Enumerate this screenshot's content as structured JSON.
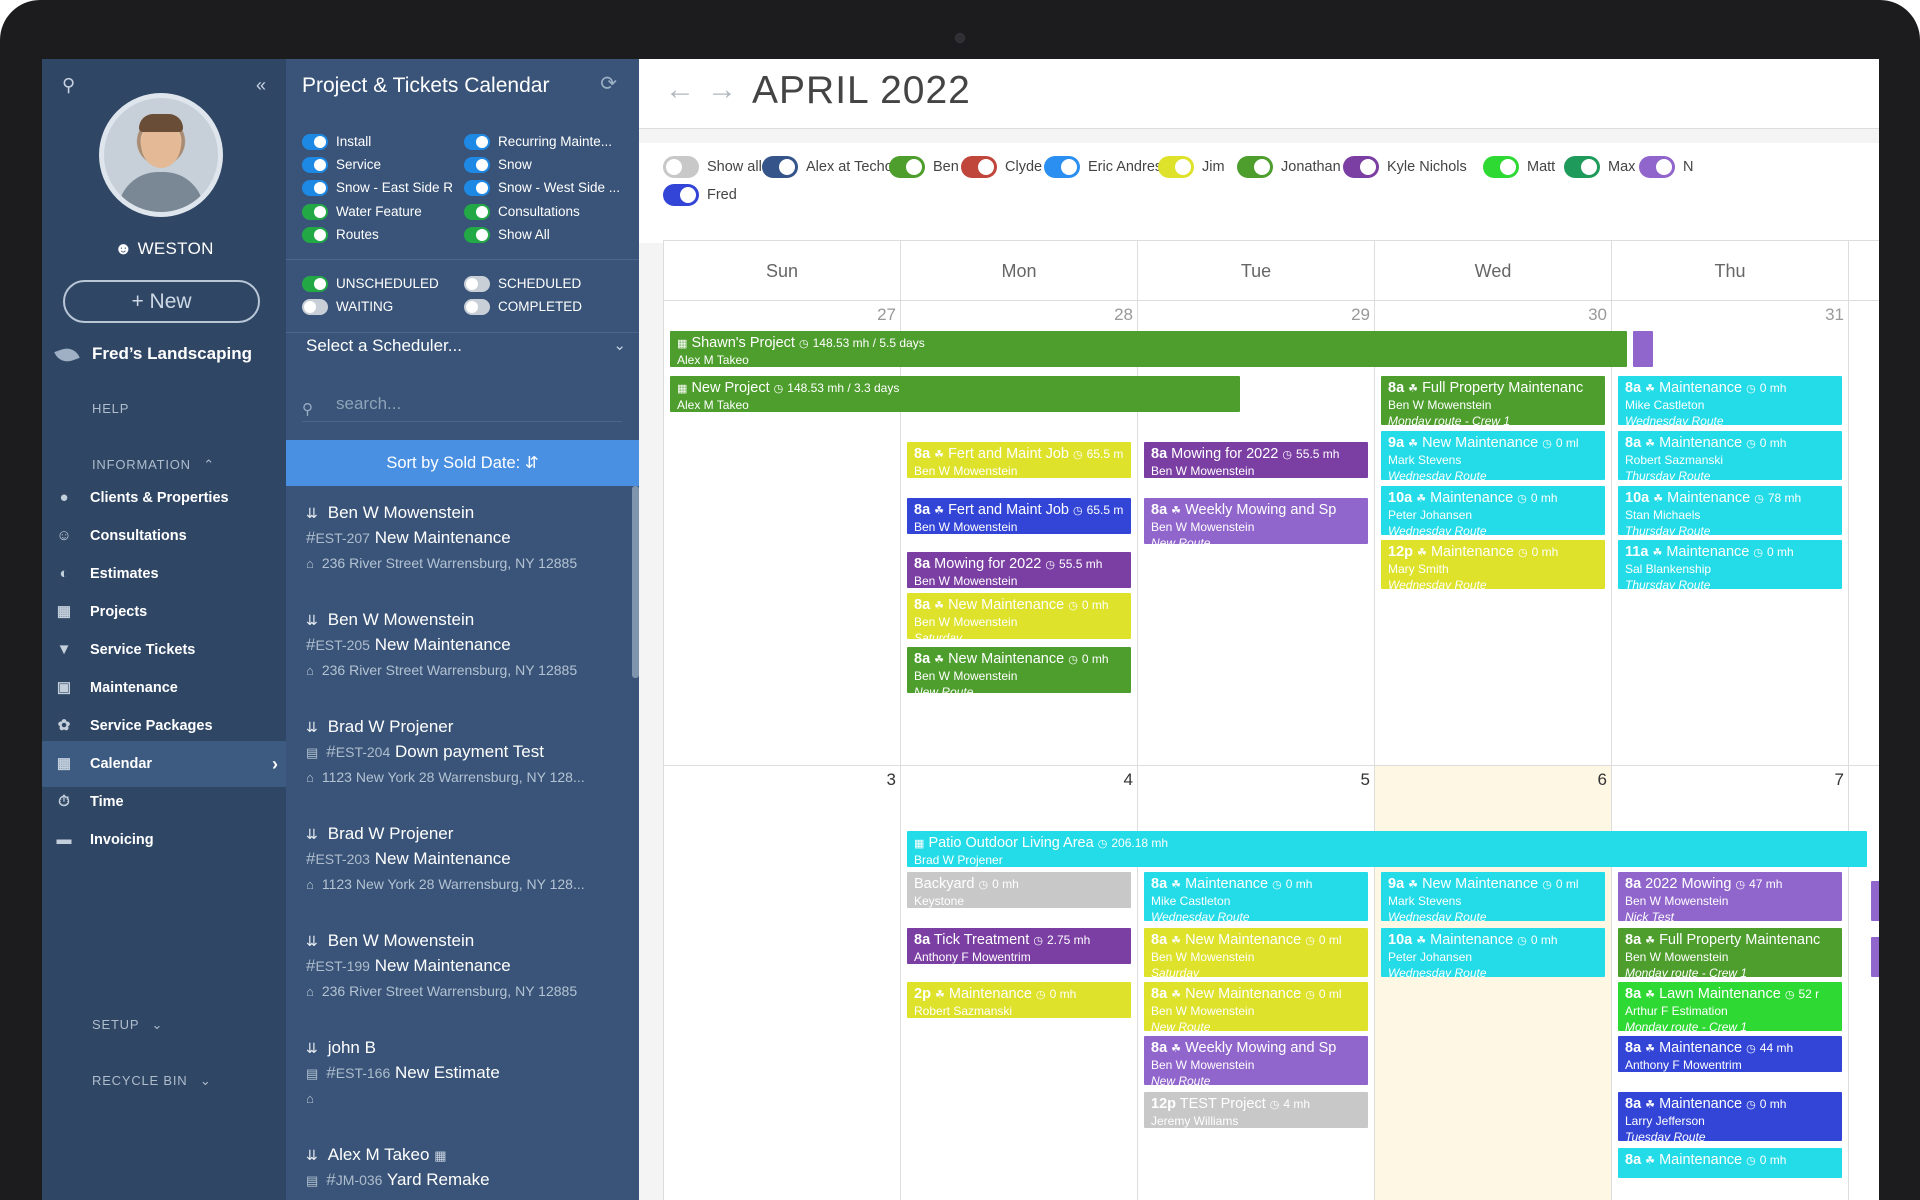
{
  "app": {
    "title": "Project & Tickets Calendar"
  },
  "sidebar": {
    "user": "WESTON",
    "new_label": "New",
    "company": "Fred’s Landscaping",
    "help": "HELP",
    "information": "INFORMATION",
    "setup": "SETUP",
    "recycle_bin": "RECYCLE BIN",
    "items": [
      {
        "label": "Clients & Properties",
        "icon": "clients-icon"
      },
      {
        "label": "Consultations",
        "icon": "consultations-icon"
      },
      {
        "label": "Estimates",
        "icon": "estimates-icon"
      },
      {
        "label": "Projects",
        "icon": "projects-icon"
      },
      {
        "label": "Service Tickets",
        "icon": "service-tickets-icon"
      },
      {
        "label": "Maintenance",
        "icon": "maintenance-icon"
      },
      {
        "label": "Service Packages",
        "icon": "service-packages-icon"
      },
      {
        "label": "Calendar",
        "icon": "calendar-icon"
      },
      {
        "label": "Time",
        "icon": "time-icon"
      },
      {
        "label": "Invoicing",
        "icon": "invoicing-icon"
      }
    ]
  },
  "panel": {
    "filters_left": [
      "Install",
      "Service",
      "Snow - East Side R...",
      "Water Feature",
      "Routes"
    ],
    "filters_right": [
      "Recurring Mainte...",
      "Snow",
      "Snow - West Side ...",
      "Consultations",
      "Show All"
    ],
    "status": {
      "unscheduled": "UNSCHEDULED",
      "waiting": "WAITING",
      "scheduled": "SCHEDULED",
      "completed": "COMPLETED"
    },
    "scheduler_placeholder": "Select a Scheduler...",
    "search_placeholder": "search...",
    "sort_label": "Sort by Sold Date:",
    "estimates": [
      {
        "name": "Ben W Mowenstein",
        "code": "EST-207",
        "title": "New Maintenance",
        "address": "236 River Street Warrensburg, NY 12885"
      },
      {
        "name": "Ben W Mowenstein",
        "code": "EST-205",
        "title": "New Maintenance",
        "address": "236 River Street Warrensburg, NY 12885"
      },
      {
        "name": "Brad W Projener",
        "code": "EST-204",
        "title": "Down payment Test",
        "address": "1123 New York 28 Warrensburg, NY 128..."
      },
      {
        "name": "Brad W Projener",
        "code": "EST-203",
        "title": "New Maintenance",
        "address": "1123 New York 28 Warrensburg, NY 128..."
      },
      {
        "name": "Ben W Mowenstein",
        "code": "EST-199",
        "title": "New Maintenance",
        "address": "236 River Street Warrensburg, NY 12885"
      },
      {
        "name": "john B",
        "code": "EST-166",
        "title": "New Estimate",
        "address": ""
      },
      {
        "name": "Alex M Takeo",
        "code": "JM-036",
        "title": "Yard Remake",
        "address": ""
      }
    ]
  },
  "calendar": {
    "month": "APRIL 2022",
    "people": [
      {
        "name": "Show all",
        "color": "#c8c8c8",
        "on": false
      },
      {
        "name": "Alex at Techo",
        "color": "#34548a",
        "on": true
      },
      {
        "name": "Ben",
        "color": "#4e9e2e",
        "on": true
      },
      {
        "name": "Clyde",
        "color": "#c0453a",
        "on": true
      },
      {
        "name": "Eric Andres",
        "color": "#2a8ff0",
        "on": true
      },
      {
        "name": "Jim",
        "color": "#dee22a",
        "on": true
      },
      {
        "name": "Jonathan",
        "color": "#4e9e2e",
        "on": true
      },
      {
        "name": "Kyle Nichols",
        "color": "#7b3ea3",
        "on": true
      },
      {
        "name": "Matt",
        "color": "#2fd934",
        "on": true
      },
      {
        "name": "Max",
        "color": "#1e9a5a",
        "on": true
      },
      {
        "name": "N",
        "color": "#9166cc",
        "on": true
      },
      {
        "name": "Fred",
        "color": "#3345d6",
        "on": true
      }
    ],
    "days": [
      "Sun",
      "Mon",
      "Tue",
      "Wed",
      "Thu"
    ],
    "week1_dates": [
      "27",
      "28",
      "29",
      "30",
      "31"
    ],
    "week2_dates": [
      "3",
      "4",
      "5",
      "6",
      "7"
    ],
    "events": {
      "shawn": {
        "title": "Shawn's Project",
        "meta": "148.53 mh / 5.5 days",
        "who": "Alex M Takeo"
      },
      "newproj": {
        "title": "New Project",
        "meta": "148.53 mh / 3.3 days",
        "who": "Alex M Takeo"
      },
      "patio": {
        "title": "Patio Outdoor Living Area",
        "meta": "206.18 mh",
        "who": "Brad W Projener"
      },
      "w1": [
        {
          "id": "mon1",
          "time": "8a",
          "title": "Fert and Maint Job",
          "mh": "65.5 m",
          "who": "Ben W Mowenstein",
          "route": ""
        },
        {
          "id": "mon2",
          "time": "8a",
          "title": "Fert and Maint Job",
          "mh": "65.5 m",
          "who": "Ben W Mowenstein",
          "route": ""
        },
        {
          "id": "mon3",
          "time": "8a",
          "title": "Mowing for 2022",
          "mh": "55.5 mh",
          "who": "Ben W Mowenstein",
          "route": ""
        },
        {
          "id": "mon4",
          "time": "8a",
          "title": "New Maintenance",
          "mh": "0 mh",
          "who": "Ben W Mowenstein",
          "route": "Saturday"
        },
        {
          "id": "mon5",
          "time": "8a",
          "title": "New Maintenance",
          "mh": "0 mh",
          "who": "Ben W Mowenstein",
          "route": "New Route"
        },
        {
          "id": "tue1",
          "time": "8a",
          "title": "Mowing for 2022",
          "mh": "55.5 mh",
          "who": "Ben W Mowenstein",
          "route": ""
        },
        {
          "id": "tue2",
          "time": "8a",
          "title": "Weekly Mowing and Sp",
          "mh": "",
          "who": "Ben W Mowenstein",
          "route": "New Route"
        },
        {
          "id": "wed1",
          "time": "8a",
          "title": "Full Property Maintenanc",
          "mh": "",
          "who": "Ben W Mowenstein",
          "route": "Monday route - Crew 1"
        },
        {
          "id": "wed2",
          "time": "9a",
          "title": "New Maintenance",
          "mh": "0 ml",
          "who": "Mark Stevens",
          "route": "Wednesday Route"
        },
        {
          "id": "wed3",
          "time": "10a",
          "title": "Maintenance",
          "mh": "0 mh",
          "who": "Peter Johansen",
          "route": "Wednesday Route"
        },
        {
          "id": "wed4",
          "time": "12p",
          "title": "Maintenance",
          "mh": "0 mh",
          "who": "Mary Smith",
          "route": "Wednesday Route"
        },
        {
          "id": "thu1",
          "time": "8a",
          "title": "Maintenance",
          "mh": "0 mh",
          "who": "Mike Castleton",
          "route": "Wednesday Route"
        },
        {
          "id": "thu2",
          "time": "8a",
          "title": "Maintenance",
          "mh": "0 mh",
          "who": "Robert Sazmanski",
          "route": "Thursday Route"
        },
        {
          "id": "thu3",
          "time": "10a",
          "title": "Maintenance",
          "mh": "78 mh",
          "who": "Stan Michaels",
          "route": "Thursday Route"
        },
        {
          "id": "thu4",
          "time": "11a",
          "title": "Maintenance",
          "mh": "0 mh",
          "who": "Sal Blankenship",
          "route": "Thursday Route"
        }
      ],
      "w2": [
        {
          "id": "mon6",
          "time": "",
          "title": "Backyard",
          "mh": "0 mh",
          "who": "Keystone",
          "route": ""
        },
        {
          "id": "mon7",
          "time": "8a",
          "title": "Tick Treatment",
          "mh": "2.75 mh",
          "who": "Anthony F Mowentrim",
          "route": ""
        },
        {
          "id": "mon8",
          "time": "2p",
          "title": "Maintenance",
          "mh": "0 mh",
          "who": "Robert Sazmanski",
          "route": ""
        },
        {
          "id": "tue3",
          "time": "8a",
          "title": "Maintenance",
          "mh": "0 mh",
          "who": "Mike Castleton",
          "route": "Wednesday Route"
        },
        {
          "id": "tue4",
          "time": "8a",
          "title": "New Maintenance",
          "mh": "0 ml",
          "who": "Ben W Mowenstein",
          "route": "Saturday"
        },
        {
          "id": "tue5",
          "time": "8a",
          "title": "New Maintenance",
          "mh": "0 ml",
          "who": "Ben W Mowenstein",
          "route": "New Route"
        },
        {
          "id": "tue6",
          "time": "8a",
          "title": "Weekly Mowing and Sp",
          "mh": "",
          "who": "Ben W Mowenstein",
          "route": "New Route"
        },
        {
          "id": "tue7",
          "time": "12p",
          "title": "TEST Project",
          "mh": "4 mh",
          "who": "Jeremy Williams",
          "route": ""
        },
        {
          "id": "wed5",
          "time": "9a",
          "title": "New Maintenance",
          "mh": "0 ml",
          "who": "Mark Stevens",
          "route": "Wednesday Route"
        },
        {
          "id": "wed6",
          "time": "10a",
          "title": "Maintenance",
          "mh": "0 mh",
          "who": "Peter Johansen",
          "route": "Wednesday Route"
        },
        {
          "id": "thu5",
          "time": "8a",
          "title": "2022 Mowing",
          "mh": "47 mh",
          "who": "Ben W Mowenstein",
          "route": "Nick Test"
        },
        {
          "id": "thu6",
          "time": "8a",
          "title": "Full Property Maintenanc",
          "mh": "",
          "who": "Ben W Mowenstein",
          "route": "Monday route - Crew 1"
        },
        {
          "id": "thu7",
          "time": "8a",
          "title": "Lawn Maintenance",
          "mh": "52 r",
          "who": "Arthur F Estimation",
          "route": "Monday route - Crew 1"
        },
        {
          "id": "thu8",
          "time": "8a",
          "title": "Maintenance",
          "mh": "44 mh",
          "who": "Anthony F Mowentrim",
          "route": ""
        },
        {
          "id": "thu9",
          "time": "8a",
          "title": "Maintenance",
          "mh": "0 mh",
          "who": "Larry Jefferson",
          "route": "Tuesday Route"
        },
        {
          "id": "thu10",
          "time": "8a",
          "title": "Maintenance",
          "mh": "0 mh",
          "who": "",
          "route": ""
        }
      ]
    }
  }
}
